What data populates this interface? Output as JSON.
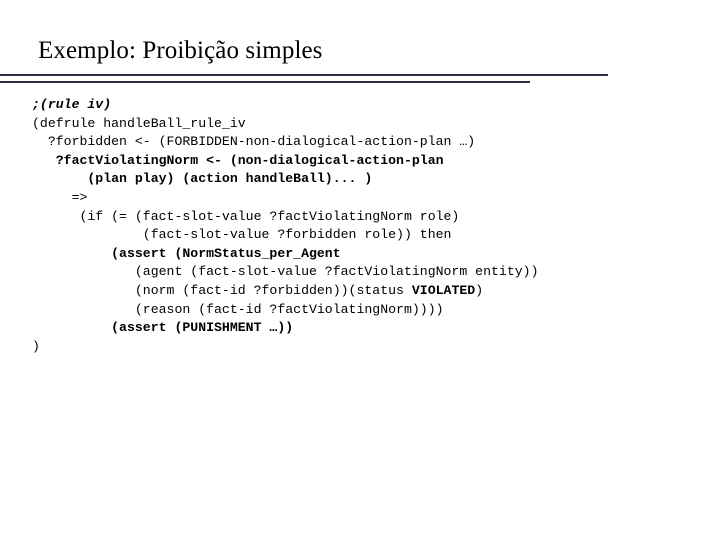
{
  "slide": {
    "title": "Exemplo: Proibição simples",
    "divider_color": "#332e46",
    "background_color": "#ffffff",
    "text_color": "#000000"
  },
  "code": {
    "lines": [
      {
        "indent": 0,
        "segments": [
          {
            "text": ";(rule iv)",
            "style": "bold-italic"
          }
        ]
      },
      {
        "indent": 0,
        "segments": [
          {
            "text": "(defrule handleBall_rule_iv",
            "style": "regular"
          }
        ]
      },
      {
        "indent": 2,
        "segments": [
          {
            "text": "?forbidden <- (FORBIDDEN-non-dialogical-action-plan …)",
            "style": "regular"
          }
        ]
      },
      {
        "indent": 3,
        "segments": [
          {
            "text": "?factViolatingNorm <- (non-dialogical-action-plan",
            "style": "bold"
          }
        ]
      },
      {
        "indent": 7,
        "segments": [
          {
            "text": "(plan play) (action handleBall)... )",
            "style": "bold"
          }
        ]
      },
      {
        "indent": 5,
        "segments": [
          {
            "text": "=>",
            "style": "regular"
          }
        ]
      },
      {
        "indent": 6,
        "segments": [
          {
            "text": "(if (= (fact-slot-value ?factViolatingNorm role)",
            "style": "regular"
          }
        ]
      },
      {
        "indent": 14,
        "segments": [
          {
            "text": "(fact-slot-value ?forbidden role)) then",
            "style": "regular"
          }
        ]
      },
      {
        "indent": 10,
        "segments": [
          {
            "text": "(assert (NormStatus_per_Agent",
            "style": "bold"
          }
        ]
      },
      {
        "indent": 13,
        "segments": [
          {
            "text": "(agent (fact-slot-value ?factViolatingNorm entity))",
            "style": "regular"
          }
        ]
      },
      {
        "indent": 13,
        "segments": [
          {
            "text": "(norm (fact-id ?forbidden))(status ",
            "style": "regular"
          },
          {
            "text": "VIOLATED",
            "style": "bold"
          },
          {
            "text": ")",
            "style": "regular"
          }
        ]
      },
      {
        "indent": 13,
        "segments": [
          {
            "text": "(reason (fact-id ?factViolatingNorm))))",
            "style": "regular"
          }
        ]
      },
      {
        "indent": 10,
        "segments": [
          {
            "text": "(assert (PUNISHMENT …))",
            "style": "bold"
          }
        ]
      },
      {
        "indent": 0,
        "segments": [
          {
            "text": ")",
            "style": "regular"
          }
        ]
      }
    ]
  }
}
